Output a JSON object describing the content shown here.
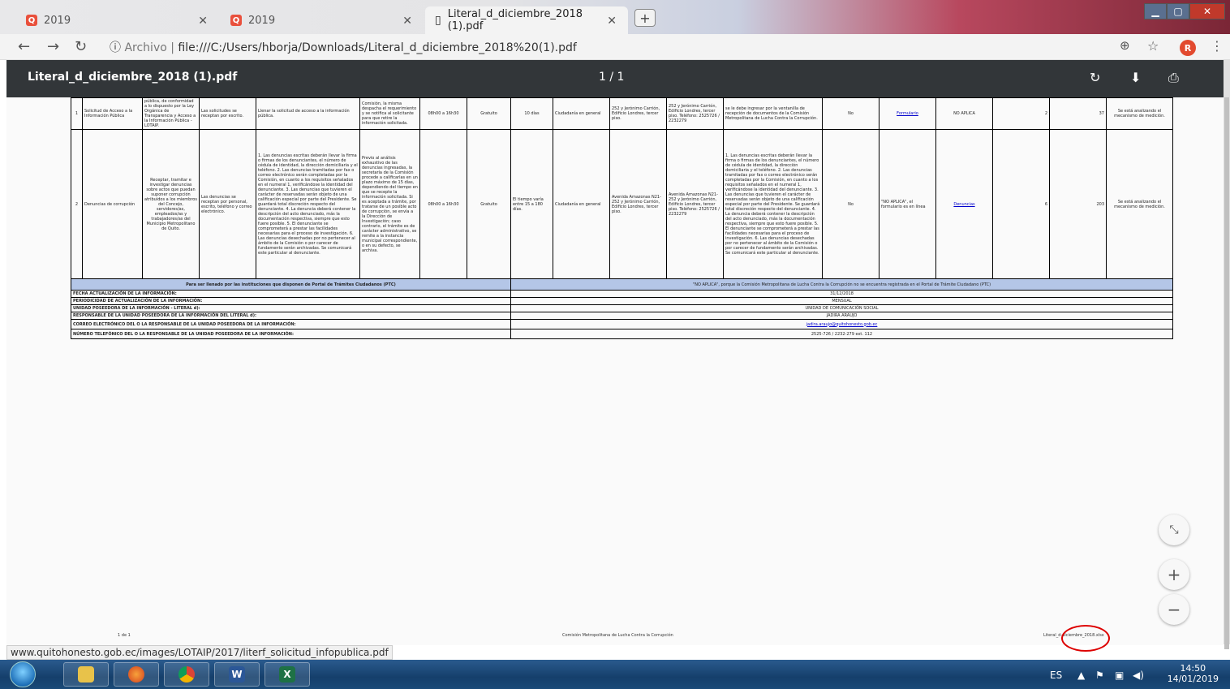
{
  "tabs": [
    {
      "label": "2019",
      "favicon": "Q"
    },
    {
      "label": "2019",
      "favicon": "Q"
    },
    {
      "label": "Literal_d_diciembre_2018 (1).pdf",
      "favicon": "doc"
    }
  ],
  "address": {
    "scheme_label": "Archivo",
    "url": "file:///C:/Users/hborja/Downloads/Literal_d_diciembre_2018%20(1).pdf"
  },
  "profile": {
    "initial": "R"
  },
  "pdf": {
    "title": "Literal_d_diciembre_2018 (1).pdf",
    "page_indicator": "1 / 1"
  },
  "rows": [
    {
      "num": "1",
      "service": "Solicitud de Acceso a la Información Pública",
      "description": "pública, de conformidad a lo dispuesto por la Ley Orgánica de Transparencia y Acceso a la Información Pública - LOTAIP.",
      "access": "Las solicitudes se receptan por escrito.",
      "procedure": "Llenar la solicitud de acceso a la información pública.",
      "process": "Comisión, la misma despacha el requerimiento y se notifica al solicitante para que retire la información solicitada.",
      "hours": "08h00 a 16h30",
      "cost": "Gratuito",
      "time": "10 días",
      "audience": "Ciudadanía en general",
      "office": "252 y Jerónimo Carrión, Edificio Londres, tercer piso.",
      "address": "252 y Jerónimo Carrión, Edificio Londres, tercer piso. Teléfono: 2525726 / 2232279",
      "type": "se le debe ingresar por la ventanilla de recepción de documentos de la Comisión Metropolitana de Lucha Contra la Corrupción.",
      "online": "No",
      "link": "Formulario",
      "link2": "NO APLICA",
      "n1": "2",
      "n2": "37",
      "notes": "Se está analizando el mecanismo de medición."
    },
    {
      "num": "2",
      "service": "Denuncias de corrupción",
      "description": "Receptar, tramitar e investigar denuncias sobre actos que puedan suponer corrupción atribuidos a los miembros del Concejo, servidores/as, empleados/as y trabajadores/as del Municipio Metropolitano de Quito.",
      "access": "Las denuncias se receptan por personal, escrito, teléfono y correo electrónico.",
      "procedure": "1. Las denuncias escritas deberán llevar la firma o firmas de los denunciantes, el número de cédula de identidad, la dirección domiciliaria y el teléfono. 2. Las denuncias tramitadas por fax o correo electrónico serán completadas por la Comisión, en cuanto a los requisitos señalados en el numeral 1, verificándose la identidad del denunciante. 3. Las denuncias que tuvieren el carácter de reservadas serán objeto de una calificación especial por parte del Presidente. Se guardará total discreción respecto del denunciante. 4. La denuncia deberá contener la descripción del acto denunciado, más la documentación respectiva, siempre que esto fuere posible. 5. El denunciante se comprometerá a prestar las facilidades necesarias para el proceso de investigación. 6. Las denuncias desechadas por no pertenecer al ámbito de la Comisión o por carecer de fundamento serán archivadas. Se comunicará este particular al denunciante.",
      "process": "Previo al análisis exhaustivo de las denuncias ingresadas, la secretaría de la Comisión procede a calificarlas en un plazo máximo de 15 días, dependiendo del tiempo en que se recepte la información solicitada. Si es aceptada a trámite, por tratarse de un posible acto de corrupción, se envía a la Dirección de Investigación; caso contrario, el trámite es de carácter administrativo, se remite a la instancia municipal correspondiente, o en su defecto, se archiva.",
      "hours": "08h00 a 16h30",
      "cost": "Gratuito",
      "time": "El tiempo varía entre 15 a 180 días.",
      "audience": "Ciudadanía en general",
      "office": "Avenida Amazonas N21-252 y Jerónimo Carrión, Edificio Londres, tercer piso.",
      "address": "Avenida Amazonas N21-252 y Jerónimo Carrión, Edificio Londres, tercer piso. Teléfono: 2525726 / 2232279",
      "type": "1. Las denuncias escritas deberán llevar la firma o firmas de los denunciantes, el número de cédula de identidad, la dirección domiciliaria y el teléfono. 2. Las denuncias tramitadas por fax o correo electrónico serán completadas por la Comisión, en cuanto a los requisitos señalados en el numeral 1, verificándose la identidad del denunciante. 3. Las denuncias que tuvieren el carácter de reservadas serán objeto de una calificación especial por parte del Presidente. Se guardará total discreción respecto del denunciante. 4. La denuncia deberá contener la descripción del acto denunciado, más la documentación respectiva, siempre que esto fuere posible. 5. El denunciante se comprometerá a prestar las facilidades necesarias para el proceso de investigación. 6. Las denuncias desechadas por no pertenecer al ámbito de la Comisión o por carecer de fundamento serán archivadas. Se comunicará este particular al denunciante.",
      "online": "No",
      "link": "\"NO APLICA\", el formulario es en línea",
      "link2": "Denuncias",
      "n1": "6",
      "n2": "203",
      "notes": "Se está analizando el mecanismo de medición."
    }
  ],
  "ptc": {
    "left": "Para ser llenado por las instituciones que disponen de Portal de Trámites Ciudadanos (PTC)",
    "right": "\"NO APLICA\", porque la Comisión Metropolitana de Lucha Contra la Corrupción no se encuentra registrada en el Portal de Trámite Ciudadano (PTC)"
  },
  "meta": [
    {
      "label": "FECHA ACTUALIZACIÓN DE LA INFORMACIÓN:",
      "value": "31/12/2018"
    },
    {
      "label": "PERIODICIDAD DE ACTUALIZACIÓN DE LA INFORMACIÓN:",
      "value": "MENSUAL"
    },
    {
      "label": "UNIDAD POSEEDORA DE LA INFORMACIÓN - LITERAL d):",
      "value": "UNIDAD DE COMUNICACIÓN SOCIAL"
    },
    {
      "label": "RESPONSABLE DE LA UNIDAD POSEEDORA DE LA INFORMACIÓN DEL LITERAL d):",
      "value": "JADIRA ARAUJO"
    },
    {
      "label": "CORREO ELECTRÓNICO DEL O LA RESPONSABLE DE LA UNIDAD POSEEDORA DE LA INFORMACIÓN:",
      "value": "jadira.araujo@quitohonesto.gob.ec"
    },
    {
      "label": "NÚMERO TELEFÓNICO DEL O LA RESPONSABLE DE LA UNIDAD POSEEDORA DE LA INFORMACIÓN:",
      "value": "2525-726 / 2232-279 ext. 112"
    }
  ],
  "footer": {
    "left": "1 de 1",
    "center": "Comisión Metropolitana de Lucha Contra la Corrupción",
    "right": "Literal_d-diciembre_2018.xlsx"
  },
  "status_url": "www.quitohonesto.gob.ec/images/LOTAIP/2017/literf_solicitud_infopublica.pdf",
  "tray": {
    "lang": "ES",
    "time": "14:50",
    "date": "14/01/2019"
  }
}
